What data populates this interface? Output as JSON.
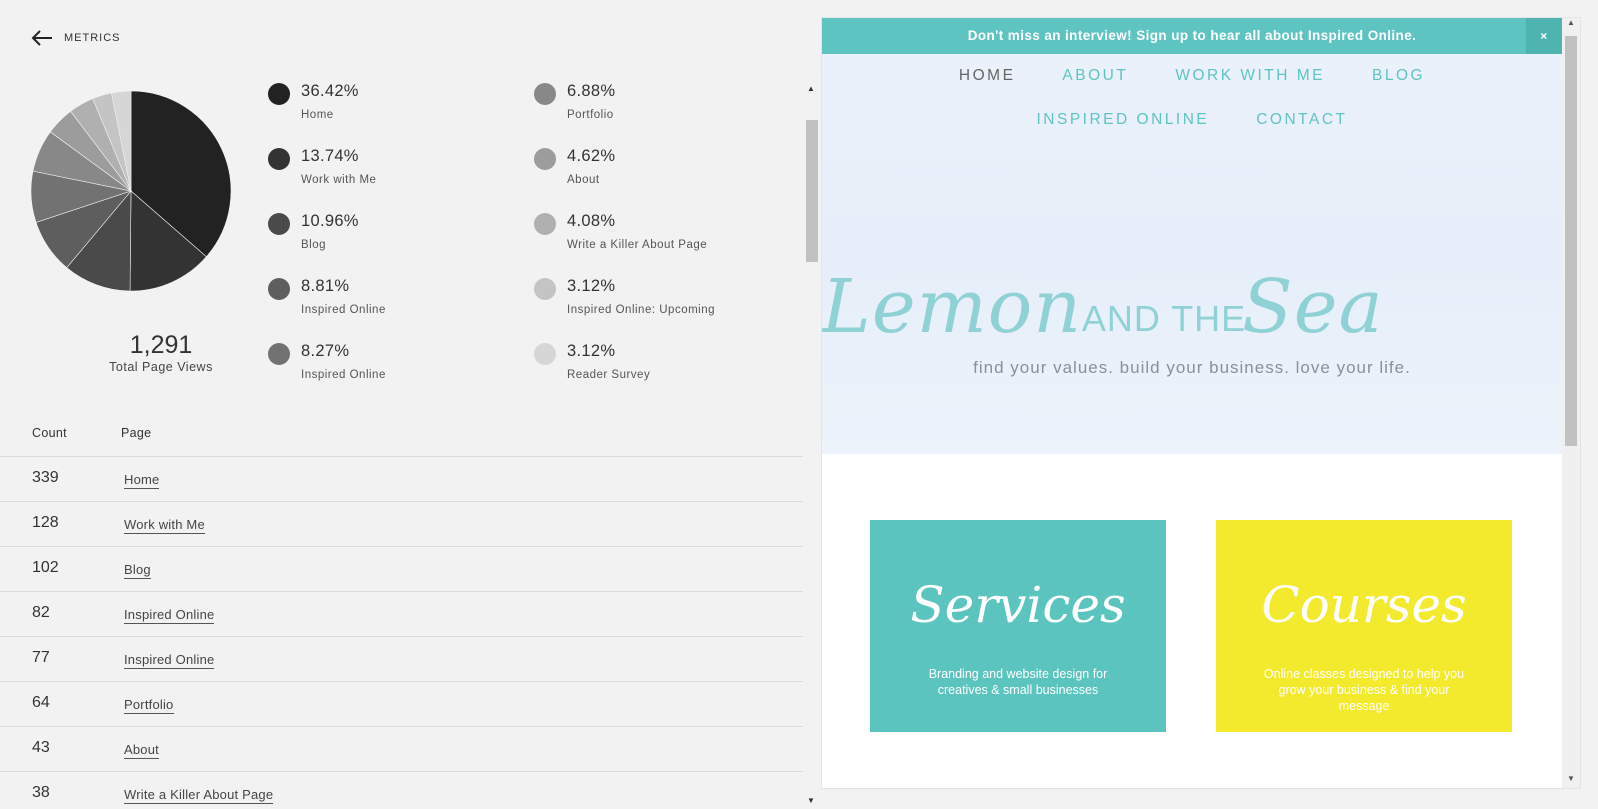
{
  "header": {
    "back_label": "METRICS"
  },
  "chart_data": {
    "type": "pie",
    "slices": [
      {
        "label": "Home",
        "value": 36.42,
        "color": "#222222"
      },
      {
        "label": "Work with Me",
        "value": 13.74,
        "color": "#333333"
      },
      {
        "label": "Blog",
        "value": 10.96,
        "color": "#4a4a4a"
      },
      {
        "label": "Inspired Online",
        "value": 8.81,
        "color": "#5e5e5e"
      },
      {
        "label": "Inspired Online",
        "value": 8.27,
        "color": "#727272"
      },
      {
        "label": "Portfolio",
        "value": 6.88,
        "color": "#888888"
      },
      {
        "label": "About",
        "value": 4.62,
        "color": "#9c9c9c"
      },
      {
        "label": "Write a Killer About Page",
        "value": 4.08,
        "color": "#b0b0b0"
      },
      {
        "label": "Inspired Online: Upcoming",
        "value": 3.12,
        "color": "#c4c4c4"
      },
      {
        "label": "Reader Survey",
        "value": 3.12,
        "color": "#d6d6d6"
      }
    ]
  },
  "summary": {
    "total": "1,291",
    "total_label": "Total Page Views"
  },
  "legend": [
    {
      "pct": "36.42%",
      "name": "Home",
      "color": "#222222"
    },
    {
      "pct": "13.74%",
      "name": "Work with Me",
      "color": "#333333"
    },
    {
      "pct": "10.96%",
      "name": "Blog",
      "color": "#4a4a4a"
    },
    {
      "pct": "8.81%",
      "name": "Inspired Online",
      "color": "#5e5e5e"
    },
    {
      "pct": "8.27%",
      "name": "Inspired Online",
      "color": "#727272"
    },
    {
      "pct": "6.88%",
      "name": "Portfolio",
      "color": "#888888"
    },
    {
      "pct": "4.62%",
      "name": "About",
      "color": "#9c9c9c"
    },
    {
      "pct": "4.08%",
      "name": "Write a Killer About Page",
      "color": "#b0b0b0"
    },
    {
      "pct": "3.12%",
      "name": "Inspired Online: Upcoming",
      "color": "#c4c4c4"
    },
    {
      "pct": "3.12%",
      "name": "Reader Survey",
      "color": "#d6d6d6"
    }
  ],
  "table": {
    "headers": {
      "count": "Count",
      "page": "Page"
    },
    "rows": [
      {
        "count": "339",
        "page": "Home"
      },
      {
        "count": "128",
        "page": "Work with Me"
      },
      {
        "count": "102",
        "page": "Blog"
      },
      {
        "count": "82",
        "page": "Inspired Online"
      },
      {
        "count": "77",
        "page": "Inspired Online"
      },
      {
        "count": "64",
        "page": "Portfolio"
      },
      {
        "count": "43",
        "page": "About"
      },
      {
        "count": "38",
        "page": "Write a Killer About Page"
      }
    ]
  },
  "preview": {
    "banner_text": "Don't miss an interview! Sign up to hear all about Inspired Online.",
    "banner_close": "×",
    "nav_row1": [
      "HOME",
      "ABOUT",
      "WORK WITH ME",
      "BLOG"
    ],
    "nav_row2": [
      "INSPIRED ONLINE",
      "CONTACT"
    ],
    "logo": {
      "part1": "Lemon",
      "part2": "AND THE",
      "part3": "Sea"
    },
    "tagline": "find your values. build your business. love your life.",
    "cards": [
      {
        "title": "Services",
        "desc": "Branding and website design for creatives & small businesses"
      },
      {
        "title": "Courses",
        "desc": "Online classes designed to help you grow your business & find your message"
      }
    ],
    "accent_color": "#5dc4c1",
    "yellow_color": "#f4ea2d"
  }
}
